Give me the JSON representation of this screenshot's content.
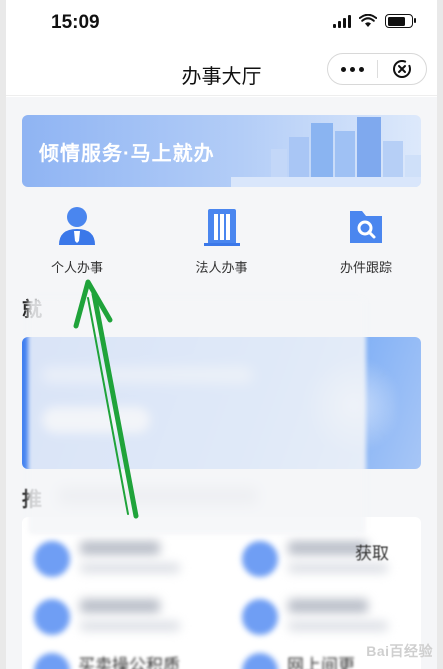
{
  "status_bar": {
    "time": "15:09"
  },
  "nav": {
    "title": "办事大厅"
  },
  "banner": {
    "text": "倾情服务·马上就办"
  },
  "quick_actions": [
    {
      "label": "个人办事",
      "icon": "person-icon"
    },
    {
      "label": "法人办事",
      "icon": "building-icon"
    },
    {
      "label": "办件跟踪",
      "icon": "folder-search-icon"
    }
  ],
  "sections": {
    "first_heading": "就",
    "second_heading": "推"
  },
  "list_fragments": {
    "right_top": "获取",
    "left_bottom": "买卖操公积质",
    "right_bottom": "网上间更"
  },
  "watermark": "Bai百经验",
  "colors": {
    "accent_blue": "#3f7ef0",
    "arrow_green": "#1fa33a",
    "banner_start": "#8fb4f3"
  }
}
